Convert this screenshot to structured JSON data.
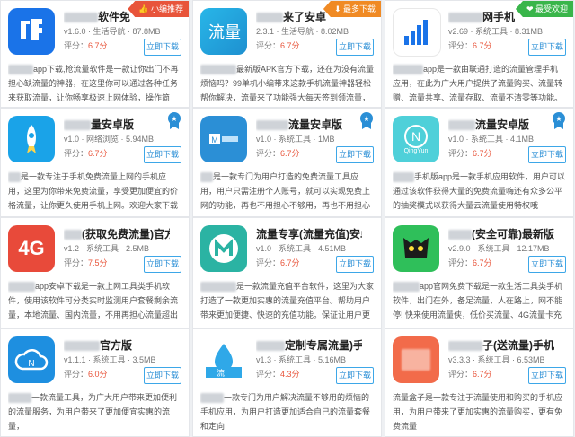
{
  "colors": {
    "accent": "#3da7e8",
    "score": "#e8543a",
    "ribbon_red": "#e8543a",
    "ribbon_orange": "#f08a24",
    "ribbon_green": "#39b54a"
  },
  "cards": [
    {
      "title": "软件免",
      "meta": "v1.6.0 · 生活导航 · 87.8MB",
      "score_label": "评分：",
      "score": "6.7分",
      "download": "立即下载",
      "ribbon": "小编推荐",
      "ribbon_icon": "thumb-up-icon",
      "desc": "app下载,抢流量软件是一款让你出门不再担心缺流量的神器，在这里你可以通过各种任务来获取流量，让你畅享极速上网体验，操作简单、使用方便，"
    },
    {
      "title": "来了安卓",
      "meta": "2.3.1 · 生活导航 · 8.02MB",
      "score_label": "评分：",
      "score": "6.7分",
      "download": "立即下载",
      "ribbon": "最多下载",
      "ribbon_icon": "download-icon",
      "desc": "最新版APK官方下载，还在为没有流量烦恼吗？99单机小编带来这款手机流量神器轻松帮你解决，流量来了功能强大每天签到领流量，有了这款软"
    },
    {
      "title": "网手机",
      "meta": "v2.69 · 系统工具 · 8.31MB",
      "score_label": "评分：",
      "score": "6.7分",
      "download": "立即下载",
      "ribbon": "最受欢迎",
      "ribbon_icon": "heart-icon",
      "desc": "app是一款由联通打造的流量管理手机应用，在此为广大用户提供了流量购买、流量转赠、流量共享、流量存取、流量不清零等功能。欢迎大家下载使"
    },
    {
      "title": "量安卓版",
      "meta": "v1.0 · 网络浏览 · 5.94MB",
      "score_label": "评分：",
      "score": "6.7分",
      "download": "立即下载",
      "desc": "是一款专注于手机免费流量上网的手机应用，这里为你带来免费流量，享受更加便宜的价格流量，让你更久使用手机上网。欢迎大家下载"
    },
    {
      "title": "流量安卓版",
      "meta": "v1.0 · 系统工具 · 1MB",
      "score_label": "评分：",
      "score": "6.7分",
      "download": "立即下载",
      "desc": "是一款专门为用户打造的免费流量工具应用，用户只需注册个人账号，就可以实现免费上网的功能，再也不用担心不够用，再也不用担心流量"
    },
    {
      "title": "流量安卓版",
      "meta": "v1.0 · 系统工具 · 4.1MB",
      "score_label": "评分：",
      "score": "6.7分",
      "download": "立即下载",
      "icon_text": "QingYun",
      "desc": "手机版app是一款手机应用软件，用户可以通过该软件获得大量的免费流量嗨还有众多公平的抽奖模式以获得大量云流量使用特权哦"
    },
    {
      "title": "(获取免费流量)官方",
      "meta": "v1.2 · 系统工具 · 2.5MB",
      "score_label": "评分：",
      "score": "7.5分",
      "download": "立即下载",
      "icon_text": "4G",
      "desc": "app安卓下载是一款上网工具类手机软件，使用该软件可分类实时监测用户套餐剩余流量，本地流量、国内流量，不用再担心流量超出的问题了!有需要"
    },
    {
      "title": "流量专享(流量充值)安卓版",
      "meta": "v1.0 · 系统工具 · 4.51MB",
      "score_label": "评分：",
      "score": "6.7分",
      "download": "立即下载",
      "desc": "是一款流量充值平台软件，这里为大家打造了一款更加实惠的流量充值平台。帮助用户带来更加便捷、快速的充值功能。保证让用户更加放心使用"
    },
    {
      "title": "(安全可靠)最新版",
      "meta": "v2.9.0 · 系统工具 · 12.17MB",
      "score_label": "评分：",
      "score": "6.7分",
      "download": "立即下载",
      "desc": "app官网免费下载是一款生活工具类手机软件，出门在外，备足流量，人在路上，网不能停! 快来使用流量侠，低价买流量、4G流量卡充值立省"
    },
    {
      "title": "官方版",
      "meta": "v1.1.1 · 系统工具 · 3.5MB",
      "score_label": "评分：",
      "score": "6.0分",
      "download": "立即下载",
      "desc": "一款流量工具，为广大用户带来更加便利的流量服务，为用户带来了更加便宜实惠的流量，"
    },
    {
      "title": "定制专属流量)手机",
      "meta": "v1.3 · 系统工具 · 5.16MB",
      "score_label": "评分：",
      "score": "4.3分",
      "download": "立即下载",
      "desc": "一款专门为用户解决流量不够用的烦恼的手机应用，为用户打造更加适合自己的流量套餐和定向"
    },
    {
      "title": "子(送流量)手机版",
      "meta": "v3.3.3 · 系统工具 · 6.53MB",
      "score_label": "评分：",
      "score": "6.7分",
      "download": "立即下载",
      "desc": "流量盒子是一款专注于流量使用和购买的手机应用，为用户带来了更加实惠的流量购买，更有免费流量"
    }
  ]
}
